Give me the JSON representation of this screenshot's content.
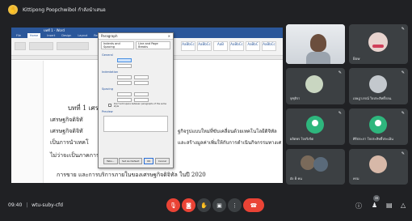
{
  "app": {
    "presenter_label": "Kittipong Poopchwibol กำลังนำเสนอ"
  },
  "word": {
    "title_bar": "บทที่ 1 - Word",
    "tabs": [
      "File",
      "Home",
      "Insert",
      "Design",
      "Layout",
      "References",
      "Mailings",
      "Review",
      "View"
    ],
    "styles": [
      "AaBbCc",
      "AaBbCc",
      "AaB",
      "AaBbCc",
      "AaBbC",
      "AaBbCc"
    ],
    "doc_lines": [
      "บทที่ 1 เศรษฐ",
      "เศรษฐกิจดิจิทั",
      "เศรษฐกิจดิจิทั",
      "เป็นการนำเทคโ",
      "ไม่ว่าจะเป็นภาคการผลิต การขนส่ง",
      "การขาย และการบริการภายในของเศรษฐกิจดิจิทัล ในปี 2020"
    ],
    "doc_right_fragments": [
      "ฐกิจรูปแบบใหม่ที่ขับเคลื่อนด้วยเทคโนโลยีดิจิทัล",
      "และสร้างมูลค่าเพิ่มให้กับการดำเนินกิจกรรมทางเศ"
    ]
  },
  "dialog": {
    "title": "Paragraph",
    "close": "×",
    "tabs": [
      "Indents and Spacing",
      "Line and Page Breaks"
    ],
    "sections": [
      "General",
      "Indentation",
      "Spacing",
      "Preview"
    ],
    "checkbox_label": "Don't add space between paragraphs of the same style",
    "buttons": [
      "Tabs...",
      "Set As Default",
      "OK",
      "Cancel"
    ]
  },
  "participants": [
    {
      "name": "",
      "avatar_color": "#8a6d5a"
    },
    {
      "name": "Bow",
      "avatar_color": "#e8d4cf"
    },
    {
      "name": "จุฑุจิรา",
      "avatar_color": "#c9d6c1"
    },
    {
      "name": "เจษฎาภรณ์ ใจประสิทธิ์กลน",
      "avatar_color": "#c3c8cd"
    },
    {
      "name": "ผลิตพร ใจจริงจิต",
      "avatar_color": "#2eb67d"
    },
    {
      "name": "ศิริประภา ใจประสิทธิ์ประเมิน",
      "avatar_color": "#2eb67d"
    },
    {
      "name": "อัง 8 คน",
      "avatar_color": "#4a4a4a"
    },
    {
      "name": "ครม",
      "avatar_color": "#d7b8a8"
    }
  ],
  "bottom": {
    "time": "09:40",
    "meeting_code": "wtu-suby-cfd",
    "participant_count": "39"
  },
  "colors": {
    "word_blue": "#2b579a",
    "meet_red": "#ea4335",
    "meet_bg": "#202124",
    "tile_bg": "#3c4043"
  },
  "icons": {
    "mic_off": "mic-off-icon",
    "cam_off": "camera-off-icon",
    "hand": "raise-hand-icon",
    "present": "present-icon",
    "more": "more-options-icon",
    "hangup": "hang-up-icon",
    "info": "info-icon",
    "people": "people-icon",
    "chat": "chat-icon",
    "activities": "activities-icon"
  }
}
